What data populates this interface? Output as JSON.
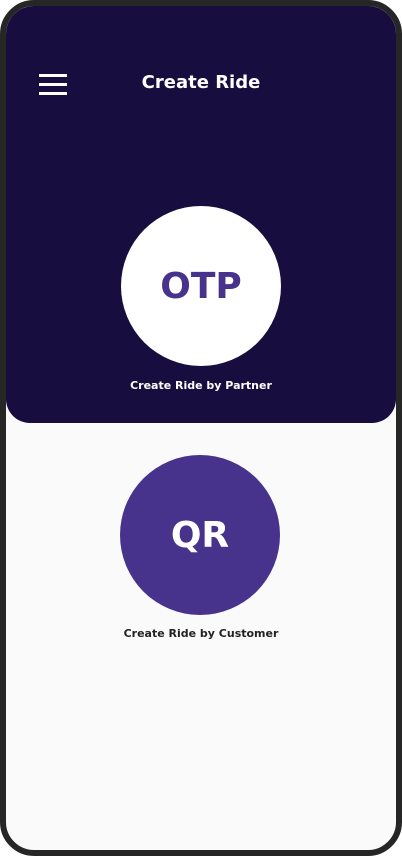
{
  "header": {
    "title": "Create Ride",
    "menu_icon": "hamburger-menu-icon"
  },
  "options": [
    {
      "label": "OTP",
      "caption": "Create Ride by Partner"
    },
    {
      "label": "QR",
      "caption": "Create Ride by Customer"
    }
  ],
  "colors": {
    "header_bg": "#170e3f",
    "accent": "#48338c",
    "background": "#fafafa"
  }
}
